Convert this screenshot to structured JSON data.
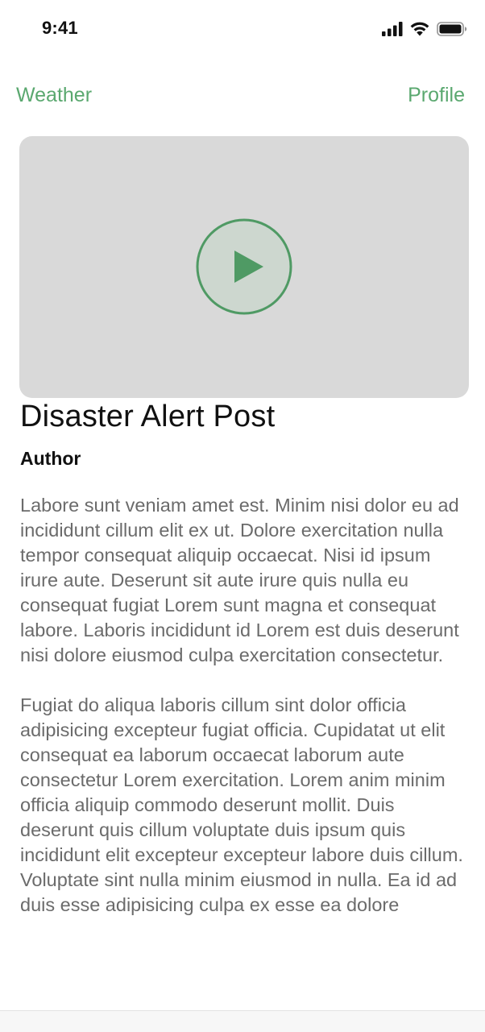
{
  "status_bar": {
    "time": "9:41",
    "icons": [
      "signal-icon",
      "wifi-icon",
      "battery-icon"
    ]
  },
  "nav": {
    "left_label": "Weather",
    "right_label": "Profile",
    "accent_color": "#5aa86f"
  },
  "video": {
    "placeholder_color": "#d9d9d9",
    "play_icon": "play-icon"
  },
  "post": {
    "title": "Disaster Alert Post",
    "author": "Author",
    "paragraphs": [
      "Labore sunt veniam amet est. Minim nisi dolor eu ad incididunt cillum elit ex ut. Dolore exercitation nulla tempor consequat aliquip occaecat. Nisi id ipsum irure aute. Deserunt sit aute irure quis nulla eu consequat fugiat Lorem sunt magna et consequat labore. Laboris incididunt id Lorem est duis deserunt nisi dolore eiusmod culpa exercitation consectetur.",
      "Fugiat do aliqua laboris cillum sint dolor officia adipisicing excepteur fugiat officia. Cupidatat ut elit consequat ea laborum occaecat laborum aute consectetur Lorem exercitation. Lorem anim minim officia aliquip commodo deserunt mollit. Duis deserunt quis cillum voluptate duis ipsum quis incididunt elit excepteur excepteur labore duis cillum. Voluptate sint nulla minim eiusmod in nulla. Ea id ad duis esse adipisicing culpa ex esse ea dolore"
    ]
  }
}
